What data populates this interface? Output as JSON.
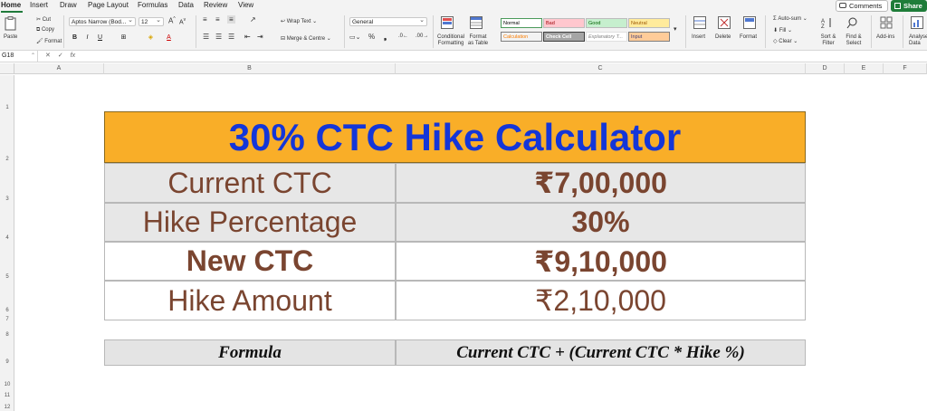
{
  "tabs": [
    "Home",
    "Insert",
    "Draw",
    "Page Layout",
    "Formulas",
    "Data",
    "Review",
    "View"
  ],
  "top_buttons": {
    "comments": "Comments",
    "share": "Share"
  },
  "clipboard": {
    "paste": "Paste",
    "cut": "Cut",
    "copy": "Copy",
    "format": "Format"
  },
  "font": {
    "name": "Aptos Narrow (Bod...",
    "size": "12"
  },
  "alignment": {
    "wrap_text": "Wrap Text",
    "merge_centre": "Merge & Centre"
  },
  "number": {
    "format": "General"
  },
  "styles_group": {
    "conditional_formatting": "Conditional Formatting",
    "format_as_table": "Format as Table",
    "cells": [
      {
        "label": "Normal",
        "bg": "#ffffff",
        "fg": "#000000"
      },
      {
        "label": "Bad",
        "bg": "#ffc7ce",
        "fg": "#9c0006"
      },
      {
        "label": "Good",
        "bg": "#c6efce",
        "fg": "#006100"
      },
      {
        "label": "Neutral",
        "bg": "#ffeb9c",
        "fg": "#9c5700"
      },
      {
        "label": "Calculation",
        "bg": "#f2f2f2",
        "fg": "#fa7d00"
      },
      {
        "label": "Check Cell",
        "bg": "#a5a5a5",
        "fg": "#ffffff"
      },
      {
        "label": "Explanatory T...",
        "bg": "#ffffff",
        "fg": "#7f7f7f"
      },
      {
        "label": "Input",
        "bg": "#ffcc99",
        "fg": "#3f3f76"
      }
    ]
  },
  "cells_group": {
    "insert": "Insert",
    "delete": "Delete",
    "format": "Format"
  },
  "editing": {
    "autosum": "Auto-sum",
    "fill": "Fill",
    "clear": "Clear",
    "sort_filter": "Sort & Filter",
    "find_select": "Find & Select"
  },
  "addins": {
    "label": "Add-ins"
  },
  "analyse": {
    "label": "Analyse Data"
  },
  "formula_bar": {
    "name_box": "G18",
    "fx": "fx",
    "content": ""
  },
  "columns": [
    "A",
    "B",
    "C",
    "D",
    "E",
    "F"
  ],
  "rows": [
    "1",
    "2",
    "3",
    "4",
    "5",
    "6",
    "7",
    "8",
    "9",
    "10",
    "11",
    "12"
  ],
  "table": {
    "title": "30% CTC Hike Calculator",
    "rows": [
      {
        "label": "Current CTC",
        "value": "₹7,00,000"
      },
      {
        "label": "Hike Percentage",
        "value": "30%"
      },
      {
        "label": "New CTC",
        "value": "₹9,10,000"
      },
      {
        "label": "Hike Amount",
        "value": "₹2,10,000"
      }
    ],
    "formula_label": "Formula",
    "formula_text": "Current CTC + (Current CTC * Hike %)"
  },
  "colors": {
    "title_bg": "#f9ae28",
    "title_text": "#1436d8",
    "body_text": "#7a4530",
    "accent": "#1f7a3a"
  }
}
